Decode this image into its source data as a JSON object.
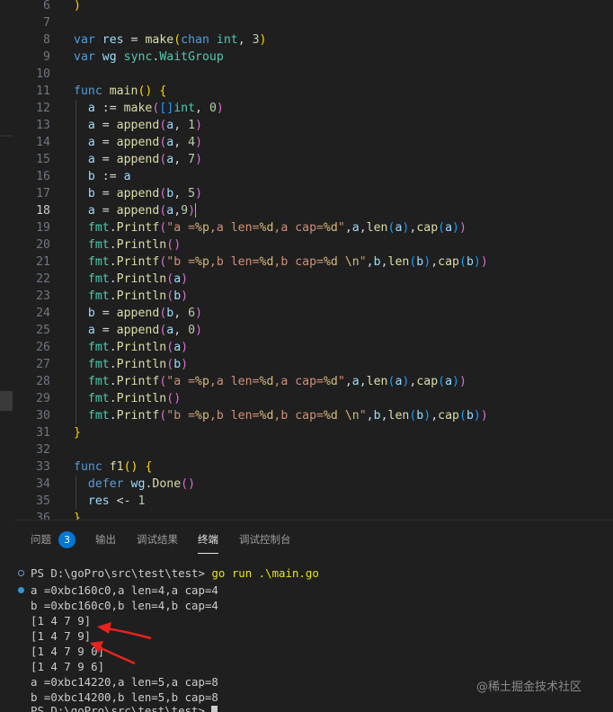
{
  "editor": {
    "active_line": 18,
    "lines": [
      {
        "n": "6",
        "tokens": [
          [
            "p1",
            ")"
          ]
        ]
      },
      {
        "n": "7",
        "tokens": []
      },
      {
        "n": "8",
        "tokens": [
          [
            "kw",
            "var"
          ],
          [
            "op",
            " "
          ],
          [
            "var",
            "res"
          ],
          [
            "op",
            " = "
          ],
          [
            "fn",
            "make"
          ],
          [
            "p1",
            "("
          ],
          [
            "kw",
            "chan"
          ],
          [
            "op",
            " "
          ],
          [
            "ty",
            "int"
          ],
          [
            "op",
            ", "
          ],
          [
            "num",
            "3"
          ],
          [
            "p1",
            ")"
          ]
        ]
      },
      {
        "n": "9",
        "tokens": [
          [
            "kw",
            "var"
          ],
          [
            "op",
            " "
          ],
          [
            "var",
            "wg"
          ],
          [
            "op",
            " "
          ],
          [
            "ty",
            "sync"
          ],
          [
            "op",
            "."
          ],
          [
            "ty",
            "WaitGroup"
          ]
        ]
      },
      {
        "n": "10",
        "tokens": []
      },
      {
        "n": "11",
        "tokens": [
          [
            "kw",
            "func"
          ],
          [
            "op",
            " "
          ],
          [
            "fn",
            "main"
          ],
          [
            "p1",
            "()"
          ],
          [
            "op",
            " "
          ],
          [
            "p1",
            "{"
          ]
        ]
      },
      {
        "n": "12",
        "tokens": [
          [
            "op",
            "  "
          ],
          [
            "var",
            "a"
          ],
          [
            "op",
            " := "
          ],
          [
            "fn",
            "make"
          ],
          [
            "p2",
            "("
          ],
          [
            "p3",
            "[]"
          ],
          [
            "ty",
            "int"
          ],
          [
            "op",
            ", "
          ],
          [
            "num",
            "0"
          ],
          [
            "p2",
            ")"
          ]
        ]
      },
      {
        "n": "13",
        "tokens": [
          [
            "op",
            "  "
          ],
          [
            "var",
            "a"
          ],
          [
            "op",
            " = "
          ],
          [
            "fn",
            "append"
          ],
          [
            "p2",
            "("
          ],
          [
            "var",
            "a"
          ],
          [
            "op",
            ", "
          ],
          [
            "num",
            "1"
          ],
          [
            "p2",
            ")"
          ]
        ]
      },
      {
        "n": "14",
        "tokens": [
          [
            "op",
            "  "
          ],
          [
            "var",
            "a"
          ],
          [
            "op",
            " = "
          ],
          [
            "fn",
            "append"
          ],
          [
            "p2",
            "("
          ],
          [
            "var",
            "a"
          ],
          [
            "op",
            ", "
          ],
          [
            "num",
            "4"
          ],
          [
            "p2",
            ")"
          ]
        ]
      },
      {
        "n": "15",
        "tokens": [
          [
            "op",
            "  "
          ],
          [
            "var",
            "a"
          ],
          [
            "op",
            " = "
          ],
          [
            "fn",
            "append"
          ],
          [
            "p2",
            "("
          ],
          [
            "var",
            "a"
          ],
          [
            "op",
            ", "
          ],
          [
            "num",
            "7"
          ],
          [
            "p2",
            ")"
          ]
        ]
      },
      {
        "n": "16",
        "tokens": [
          [
            "op",
            "  "
          ],
          [
            "var",
            "b"
          ],
          [
            "op",
            " := "
          ],
          [
            "var",
            "a"
          ]
        ]
      },
      {
        "n": "17",
        "tokens": [
          [
            "op",
            "  "
          ],
          [
            "var",
            "b"
          ],
          [
            "op",
            " = "
          ],
          [
            "fn",
            "append"
          ],
          [
            "p2",
            "("
          ],
          [
            "var",
            "b"
          ],
          [
            "op",
            ", "
          ],
          [
            "num",
            "5"
          ],
          [
            "p2",
            ")"
          ]
        ]
      },
      {
        "n": "18",
        "tokens": [
          [
            "op",
            "  "
          ],
          [
            "var",
            "a"
          ],
          [
            "op",
            " = "
          ],
          [
            "fn",
            "append"
          ],
          [
            "p2",
            "("
          ],
          [
            "var",
            "a"
          ],
          [
            "op",
            ","
          ],
          [
            "num",
            "9"
          ],
          [
            "p2",
            ")"
          ],
          [
            "cursor",
            ""
          ]
        ]
      },
      {
        "n": "19",
        "tokens": [
          [
            "op",
            "  "
          ],
          [
            "ty",
            "fmt"
          ],
          [
            "op",
            "."
          ],
          [
            "fn",
            "Printf"
          ],
          [
            "p2",
            "("
          ],
          [
            "str",
            "\"a ="
          ],
          [
            "esc",
            "%p"
          ],
          [
            "str",
            ",a len="
          ],
          [
            "esc",
            "%d"
          ],
          [
            "str",
            ",a cap="
          ],
          [
            "esc",
            "%d"
          ],
          [
            "str",
            "\""
          ],
          [
            "op",
            ","
          ],
          [
            "var",
            "a"
          ],
          [
            "op",
            ","
          ],
          [
            "fn",
            "len"
          ],
          [
            "p3",
            "("
          ],
          [
            "var",
            "a"
          ],
          [
            "p3",
            ")"
          ],
          [
            "op",
            ","
          ],
          [
            "fn",
            "cap"
          ],
          [
            "p3",
            "("
          ],
          [
            "var",
            "a"
          ],
          [
            "p3",
            ")"
          ],
          [
            "p2",
            ")"
          ]
        ]
      },
      {
        "n": "20",
        "tokens": [
          [
            "op",
            "  "
          ],
          [
            "ty",
            "fmt"
          ],
          [
            "op",
            "."
          ],
          [
            "fn",
            "Println"
          ],
          [
            "p2",
            "()"
          ]
        ]
      },
      {
        "n": "21",
        "tokens": [
          [
            "op",
            "  "
          ],
          [
            "ty",
            "fmt"
          ],
          [
            "op",
            "."
          ],
          [
            "fn",
            "Printf"
          ],
          [
            "p2",
            "("
          ],
          [
            "str",
            "\"b ="
          ],
          [
            "esc",
            "%p"
          ],
          [
            "str",
            ",b len="
          ],
          [
            "esc",
            "%d"
          ],
          [
            "str",
            ",b cap="
          ],
          [
            "esc",
            "%d"
          ],
          [
            "str",
            " "
          ],
          [
            "esc",
            "\\n"
          ],
          [
            "str",
            "\""
          ],
          [
            "op",
            ","
          ],
          [
            "var",
            "b"
          ],
          [
            "op",
            ","
          ],
          [
            "fn",
            "len"
          ],
          [
            "p3",
            "("
          ],
          [
            "var",
            "b"
          ],
          [
            "p3",
            ")"
          ],
          [
            "op",
            ","
          ],
          [
            "fn",
            "cap"
          ],
          [
            "p3",
            "("
          ],
          [
            "var",
            "b"
          ],
          [
            "p3",
            ")"
          ],
          [
            "p2",
            ")"
          ]
        ]
      },
      {
        "n": "22",
        "tokens": [
          [
            "op",
            "  "
          ],
          [
            "ty",
            "fmt"
          ],
          [
            "op",
            "."
          ],
          [
            "fn",
            "Println"
          ],
          [
            "p2",
            "("
          ],
          [
            "var",
            "a"
          ],
          [
            "p2",
            ")"
          ]
        ]
      },
      {
        "n": "23",
        "tokens": [
          [
            "op",
            "  "
          ],
          [
            "ty",
            "fmt"
          ],
          [
            "op",
            "."
          ],
          [
            "fn",
            "Println"
          ],
          [
            "p2",
            "("
          ],
          [
            "var",
            "b"
          ],
          [
            "p2",
            ")"
          ]
        ]
      },
      {
        "n": "24",
        "tokens": [
          [
            "op",
            "  "
          ],
          [
            "var",
            "b"
          ],
          [
            "op",
            " = "
          ],
          [
            "fn",
            "append"
          ],
          [
            "p2",
            "("
          ],
          [
            "var",
            "b"
          ],
          [
            "op",
            ", "
          ],
          [
            "num",
            "6"
          ],
          [
            "p2",
            ")"
          ]
        ]
      },
      {
        "n": "25",
        "tokens": [
          [
            "op",
            "  "
          ],
          [
            "var",
            "a"
          ],
          [
            "op",
            " = "
          ],
          [
            "fn",
            "append"
          ],
          [
            "p2",
            "("
          ],
          [
            "var",
            "a"
          ],
          [
            "op",
            ", "
          ],
          [
            "num",
            "0"
          ],
          [
            "p2",
            ")"
          ]
        ]
      },
      {
        "n": "26",
        "tokens": [
          [
            "op",
            "  "
          ],
          [
            "ty",
            "fmt"
          ],
          [
            "op",
            "."
          ],
          [
            "fn",
            "Println"
          ],
          [
            "p2",
            "("
          ],
          [
            "var",
            "a"
          ],
          [
            "p2",
            ")"
          ]
        ]
      },
      {
        "n": "27",
        "tokens": [
          [
            "op",
            "  "
          ],
          [
            "ty",
            "fmt"
          ],
          [
            "op",
            "."
          ],
          [
            "fn",
            "Println"
          ],
          [
            "p2",
            "("
          ],
          [
            "var",
            "b"
          ],
          [
            "p2",
            ")"
          ]
        ]
      },
      {
        "n": "28",
        "tokens": [
          [
            "op",
            "  "
          ],
          [
            "ty",
            "fmt"
          ],
          [
            "op",
            "."
          ],
          [
            "fn",
            "Printf"
          ],
          [
            "p2",
            "("
          ],
          [
            "str",
            "\"a ="
          ],
          [
            "esc",
            "%p"
          ],
          [
            "str",
            ",a len="
          ],
          [
            "esc",
            "%d"
          ],
          [
            "str",
            ",a cap="
          ],
          [
            "esc",
            "%d"
          ],
          [
            "str",
            "\""
          ],
          [
            "op",
            ","
          ],
          [
            "var",
            "a"
          ],
          [
            "op",
            ","
          ],
          [
            "fn",
            "len"
          ],
          [
            "p3",
            "("
          ],
          [
            "var",
            "a"
          ],
          [
            "p3",
            ")"
          ],
          [
            "op",
            ","
          ],
          [
            "fn",
            "cap"
          ],
          [
            "p3",
            "("
          ],
          [
            "var",
            "a"
          ],
          [
            "p3",
            ")"
          ],
          [
            "p2",
            ")"
          ]
        ]
      },
      {
        "n": "29",
        "tokens": [
          [
            "op",
            "  "
          ],
          [
            "ty",
            "fmt"
          ],
          [
            "op",
            "."
          ],
          [
            "fn",
            "Println"
          ],
          [
            "p2",
            "()"
          ]
        ]
      },
      {
        "n": "30",
        "tokens": [
          [
            "op",
            "  "
          ],
          [
            "ty",
            "fmt"
          ],
          [
            "op",
            "."
          ],
          [
            "fn",
            "Printf"
          ],
          [
            "p2",
            "("
          ],
          [
            "str",
            "\"b ="
          ],
          [
            "esc",
            "%p"
          ],
          [
            "str",
            ",b len="
          ],
          [
            "esc",
            "%d"
          ],
          [
            "str",
            ",b cap="
          ],
          [
            "esc",
            "%d"
          ],
          [
            "str",
            " "
          ],
          [
            "esc",
            "\\n"
          ],
          [
            "str",
            "\""
          ],
          [
            "op",
            ","
          ],
          [
            "var",
            "b"
          ],
          [
            "op",
            ","
          ],
          [
            "fn",
            "len"
          ],
          [
            "p3",
            "("
          ],
          [
            "var",
            "b"
          ],
          [
            "p3",
            ")"
          ],
          [
            "op",
            ","
          ],
          [
            "fn",
            "cap"
          ],
          [
            "p3",
            "("
          ],
          [
            "var",
            "b"
          ],
          [
            "p3",
            ")"
          ],
          [
            "p2",
            ")"
          ]
        ]
      },
      {
        "n": "31",
        "tokens": [
          [
            "p1",
            "}"
          ]
        ]
      },
      {
        "n": "32",
        "tokens": []
      },
      {
        "n": "33",
        "tokens": [
          [
            "kw",
            "func"
          ],
          [
            "op",
            " "
          ],
          [
            "fn",
            "f1"
          ],
          [
            "p1",
            "()"
          ],
          [
            "op",
            " "
          ],
          [
            "p1",
            "{"
          ]
        ]
      },
      {
        "n": "34",
        "tokens": [
          [
            "op",
            "  "
          ],
          [
            "kw",
            "defer"
          ],
          [
            "op",
            " "
          ],
          [
            "var",
            "wg"
          ],
          [
            "op",
            "."
          ],
          [
            "fn",
            "Done"
          ],
          [
            "p2",
            "()"
          ]
        ]
      },
      {
        "n": "35",
        "tokens": [
          [
            "op",
            "  "
          ],
          [
            "var",
            "res"
          ],
          [
            "op",
            " <- "
          ],
          [
            "num",
            "1"
          ]
        ]
      },
      {
        "n": "36",
        "tokens": [
          [
            "p1",
            "}"
          ]
        ]
      }
    ]
  },
  "panel": {
    "tabs": [
      {
        "label": "问题",
        "active": false
      },
      {
        "label": "输出",
        "active": false
      },
      {
        "label": "调试结果",
        "active": false
      },
      {
        "label": "终端",
        "active": true
      },
      {
        "label": "调试控制台",
        "active": false
      }
    ],
    "problems_count": "3"
  },
  "terminal": {
    "prompt": "PS D:\\goPro\\src\\test\\test>",
    "command": "go run .\\main.go",
    "output": [
      "a =0xbc160c0,a len=4,a cap=4",
      "b =0xbc160c0,b len=4,b cap=4",
      "[1 4 7 9]",
      "[1 4 7 9]",
      "[1 4 7 9 0]",
      "[1 4 7 9 6]",
      "a =0xbc14220,a len=5,a cap=8",
      "b =0xbc14200,b len=5,b cap=8"
    ],
    "last_prompt": "PS D:\\goPro\\src\\test\\test>"
  },
  "annotations": {
    "arrow_color": "#e8231f",
    "arrows": 2
  },
  "watermark": "@稀土掘金技术社区",
  "colors": {
    "editor_bg": "#1f1f1f",
    "keyword": "#569cd6",
    "function": "#dcdcaa",
    "number": "#b5cea8",
    "string": "#ce9178",
    "badge": "#0078d4"
  }
}
